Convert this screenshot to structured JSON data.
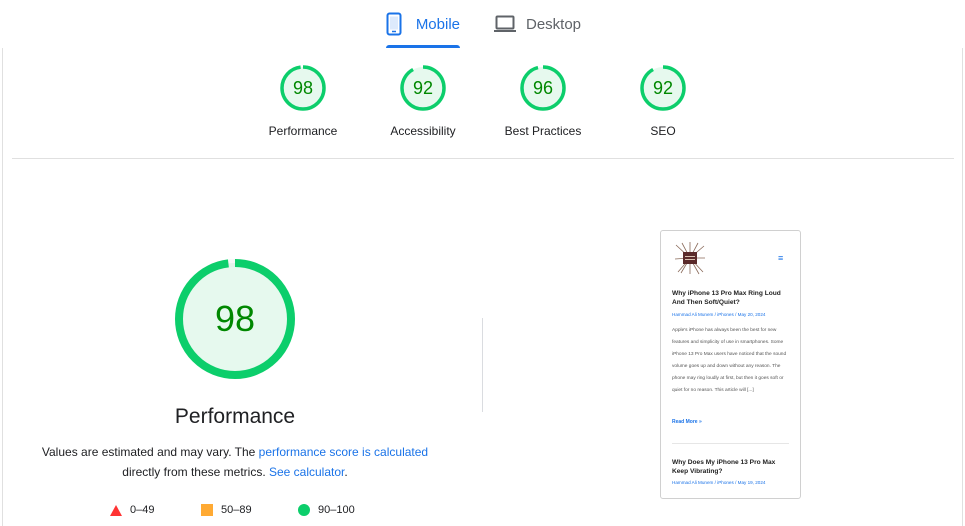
{
  "tabs": {
    "mobile": {
      "label": "Mobile",
      "icon": "smartphone-icon",
      "active": true
    },
    "desktop": {
      "label": "Desktop",
      "icon": "laptop-icon",
      "active": false
    }
  },
  "category_scores": [
    {
      "label": "Performance",
      "score": "98",
      "fraction": 0.98
    },
    {
      "label": "Accessibility",
      "score": "92",
      "fraction": 0.92
    },
    {
      "label": "Best Practices",
      "score": "96",
      "fraction": 0.96
    },
    {
      "label": "SEO",
      "score": "92",
      "fraction": 0.92
    }
  ],
  "performance": {
    "score": "98",
    "fraction": 0.98,
    "title": "Performance",
    "note_prefix": "Values are estimated and may vary. The ",
    "note_link": "performance score is calculated",
    "note_middle": " directly from these metrics. ",
    "calculator_link": "See calculator",
    "note_suffix": "."
  },
  "legend": {
    "fail": "0–49",
    "average": "50–89",
    "pass": "90–100"
  },
  "colors": {
    "accent": "#1a73e8",
    "pass": "#0cce6b",
    "pass_text": "#008800",
    "pass_bg": "#e6f9ee",
    "average": "#ffaa33",
    "fail": "#ff3333"
  },
  "screenshot": {
    "menu_icon": "≡",
    "posts": [
      {
        "title": "Why iPhone 13 Pro Max Ring Loud And Then Soft/Quiet?",
        "meta": "Hammad Ali Munem / iPhones / May 20, 2024",
        "excerpt": "Apple's iPhone has always been the best for new features and simplicity of use in smartphones.  Some iPhone 13 Pro Max users have noticed that the sound volume goes up and down without any reason. The phone may ring loudly at first, but then it goes soft or quiet for no reason.  This article will [...]",
        "read_more": "Read More »"
      },
      {
        "title": "Why Does My iPhone 13 Pro Max Keep Vibrating?",
        "meta": "Hammad Ali Munem / iPhones / May 19, 2024"
      }
    ]
  }
}
